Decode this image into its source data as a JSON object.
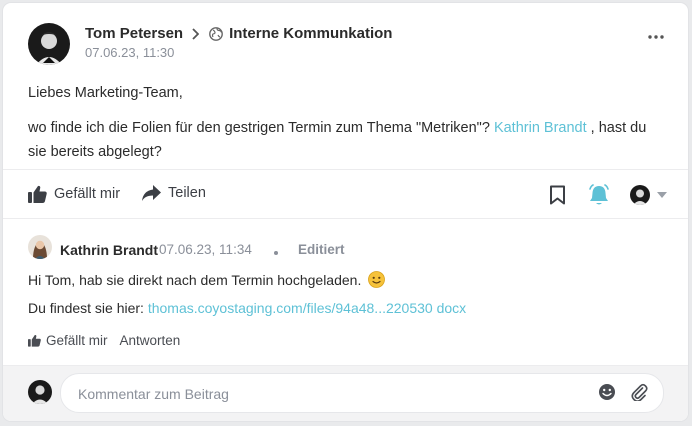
{
  "post": {
    "author": "Tom Petersen",
    "group": "Interne Kommunkation",
    "timestamp": "07.06.23, 11:30",
    "greeting": "Liebes Marketing-Team,",
    "body_before": "wo finde ich die Folien für den gestrigen Termin zum Thema \"Metriken\"?",
    "mention": "Kathrin Brandt",
    "body_after": ", hast du sie bereits abgelegt?"
  },
  "actions": {
    "like": "Gefällt mir",
    "share": "Teilen"
  },
  "comment": {
    "author": "Kathrin Brandt",
    "timestamp": "07.06.23, 11:34",
    "edited": "Editiert",
    "line1": "Hi Tom, hab sie direkt nach dem Termin hochgeladen.",
    "emoji": "🙂",
    "line2_prefix": "Du findest sie hier:",
    "link": "thomas.coyostaging.com/files/94a48...220530 docx",
    "like": "Gefällt mir",
    "reply": "Antworten"
  },
  "composer": {
    "placeholder": "Kommentar zum Beitrag"
  },
  "colors": {
    "accent": "#5ec1d6",
    "text": "#2b2b2b",
    "muted": "#8a8f99"
  }
}
